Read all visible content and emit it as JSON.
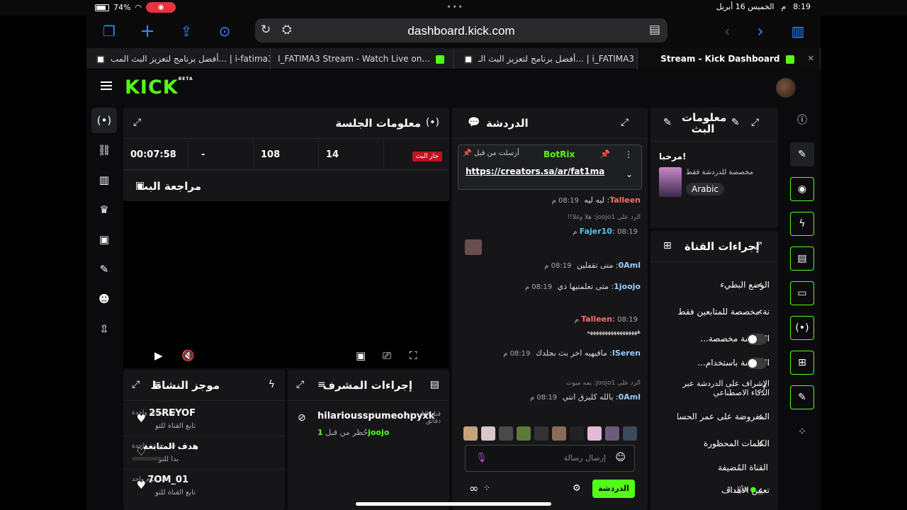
{
  "status": {
    "time": "8:19",
    "ampm": "م",
    "date": "الخميس 16 أبريل",
    "battery": "74%"
  },
  "browser": {
    "url": "dashboard.kick.com"
  },
  "tabs": [
    {
      "label": "أفضل برنامج لتعزيز البث المب... | i-fatima3"
    },
    {
      "label": "I_FATIMA3 Stream - Watch Live on..."
    },
    {
      "label": "أفضل برنامج لتعزيز البث الـ... | i_FATIMA3"
    },
    {
      "label": "Stream - Kick Dashboard"
    }
  ],
  "brand": {
    "logo": "KICK",
    "beta": "BETA"
  },
  "session": {
    "title": "معلومات الجلسة",
    "live_badge": "جار البث",
    "stats": [
      "14",
      "108",
      "-",
      "00:07:58"
    ]
  },
  "review": {
    "title": "مراجعة البث"
  },
  "chat": {
    "title": "الدردشة",
    "pinned_user": "BotRix",
    "pinned_sent_by": "أرسلت من قبل",
    "pinned_link": "https://creators.sa/ar/fat1ma",
    "messages": [
      {
        "user": "Talleen",
        "text": "ليه ليه",
        "time": "08:19 م"
      },
      {
        "reply": "الرد على joojo1: هلا وغلا!!"
      },
      {
        "user": "Fajer10",
        "text": "",
        "time": "08:19 م"
      },
      {
        "user": "0Aml",
        "text": "متى تقفلين",
        "time": "08:19 م"
      },
      {
        "user": "1joojo",
        "text": "متى تعلمتيها ذي",
        "time": "08:19 م"
      },
      {
        "user": "Talleen",
        "text": "هههههههههههههههههه",
        "time": "08:19 م"
      },
      {
        "user": "lSeren",
        "text": "مافيهيه اخر بث بجلدك",
        "time": "08:19 م"
      },
      {
        "reply": "الرد على joojo1: يمه ميوت"
      },
      {
        "user": "0Aml",
        "text": "بالله كليزق انتي",
        "time": "08:19 م"
      }
    ],
    "input_placeholder": "إرسال رسالة",
    "send_label": "الدردشة"
  },
  "stream_info": {
    "title": "معلومات البث",
    "greeting": "مرحبا!",
    "subtitle": "مخصصة للدردشة فقط",
    "language": "Arabic"
  },
  "channel_actions": {
    "title": "إجراءات القناة",
    "items": [
      {
        "label": "الوضع البطيء",
        "kind": "chevron"
      },
      {
        "label": "نة مخصصة للمتابعين فقط",
        "kind": "chevron"
      },
      {
        "label": "الدردشة مخصصة...",
        "kind": "toggle"
      },
      {
        "label": "الدردشة باستخدام...",
        "kind": "toggle"
      },
      {
        "label": "الإشراف على الدردشة عبر الذكاء الاصطناعي",
        "kind": "external"
      },
      {
        "label": "المفروضة على عمر الحساب",
        "kind": "chevron"
      },
      {
        "label": "الكلمات المحظورة",
        "kind": "chevron"
      },
      {
        "label": "القناة المُضيفة",
        "kind": "none"
      },
      {
        "label": "تعيين الأهداف",
        "kind": "chevron",
        "badge": "فعال 1"
      }
    ]
  },
  "activity": {
    "title": "موجز النشاط",
    "items": [
      {
        "name": "25REYOF",
        "sub": "تابع القناة للتو",
        "time": "قبل ساعة واحدة"
      },
      {
        "name": "هدف المتابعة",
        "sub": "بدا للتو",
        "time": "قبل ساعة واحدة"
      },
      {
        "name": "7OM_01",
        "sub": "تابع القناة للتو",
        "time": "قبل يوم واحد"
      }
    ]
  },
  "mod_actions": {
    "title": "إجراءات المشرف",
    "items": [
      {
        "user": "hilariousspumeohpyxk",
        "time": "قبل 10 دقائق",
        "by": "1joojo",
        "action": "حُظر من قبل"
      }
    ]
  },
  "colors": {
    "kick_green": "#53fc18",
    "bg": "#0b0b0d",
    "panel": "#161618"
  }
}
